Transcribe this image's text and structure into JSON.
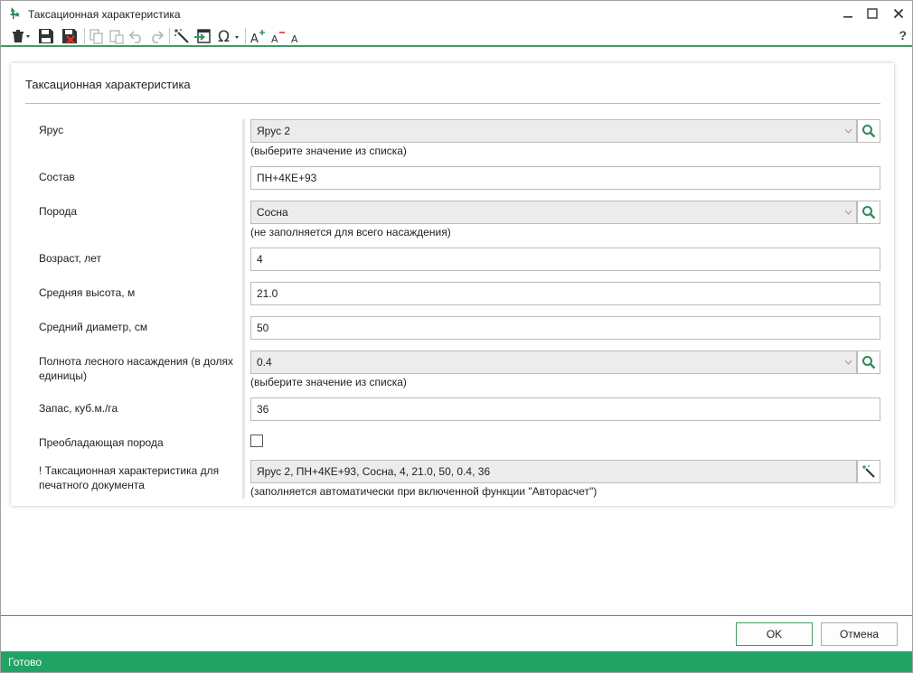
{
  "window": {
    "title": "Таксационная характеристика",
    "app_icon": "tree-icon",
    "controls": [
      "minimize-icon",
      "maximize-icon",
      "close-icon"
    ]
  },
  "toolbar": {
    "icons": [
      "delete-icon",
      "save-icon",
      "save-close-icon",
      "copy-icon",
      "paste-icon",
      "undo-icon",
      "redo-icon",
      "magic-wand-icon",
      "import-icon",
      "omega-icon",
      "font-increase-icon",
      "font-decrease-icon",
      "font-reset-icon"
    ],
    "help_label": "?"
  },
  "panel": {
    "title": "Таксационная характеристика",
    "fields": {
      "tier": {
        "label": "Ярус",
        "value": "Ярус 2",
        "hint": "(выберите значение из списка)"
      },
      "composition": {
        "label": "Состав",
        "value": "ПН+4КЕ+93"
      },
      "species": {
        "label": "Порода",
        "value": "Сосна",
        "hint": "(не заполняется для всего насаждения)"
      },
      "age": {
        "label": "Возраст, лет",
        "value": "4"
      },
      "height": {
        "label": "Средняя высота, м",
        "value": "21.0"
      },
      "diameter": {
        "label": "Средний диаметр, см",
        "value": "50"
      },
      "density": {
        "label": "Полнота лесного насаждения (в долях единицы)",
        "value": "0.4",
        "hint": "(выберите значение из списка)"
      },
      "stock": {
        "label": "Запас, куб.м./га",
        "value": "36"
      },
      "dominant": {
        "label": "Преобладающая порода",
        "checked": false
      },
      "print_text": {
        "label": "! Таксационная характеристика для печатного документа",
        "value": "Ярус 2, ПН+4КЕ+93, Сосна, 4, 21.0, 50, 0.4, 36",
        "hint": "(заполняется автоматически при включенной функции \"Авторасчет\")"
      }
    }
  },
  "buttons": {
    "ok": "OK",
    "cancel": "Отмена"
  },
  "status": {
    "text": "Готово"
  },
  "colors": {
    "accent": "#21a366",
    "rule": "#3e9b62"
  }
}
